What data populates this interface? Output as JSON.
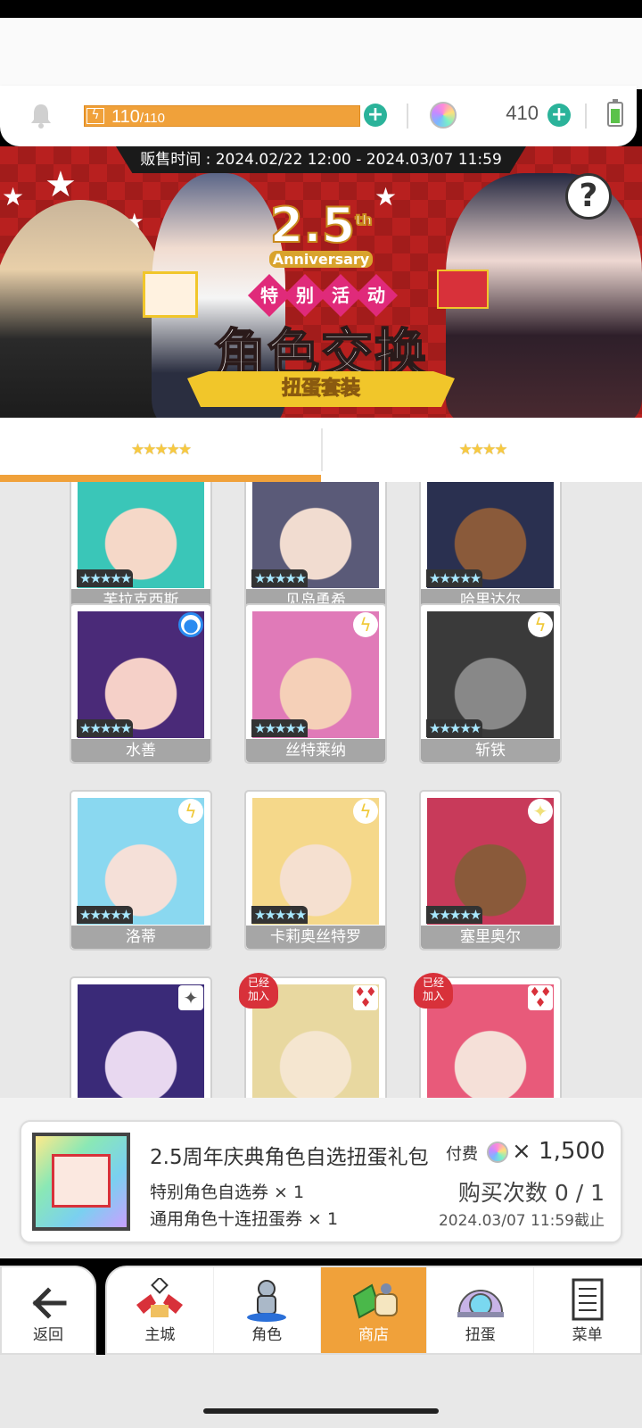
{
  "resources": {
    "stamina_current": "110",
    "stamina_max": "/110",
    "stamina_fill_fraction": 1.0,
    "stamina_icon": "lightning-icon",
    "gems": "410",
    "plus": "+"
  },
  "banner": {
    "sale_time": "贩售时间 : 2024.02/22 12:00 - 2024.03/07 11:59",
    "anniversary_number": "2.5",
    "anniversary_suffix": "th",
    "anniversary_word": "Anniversary",
    "event_tag": [
      "特",
      "别",
      "活",
      "动"
    ],
    "title": "角色交换",
    "ribbon": "扭蛋套装",
    "help": "?"
  },
  "tabs": [
    {
      "label": "★★★★★",
      "active": true
    },
    {
      "label": "★★★★",
      "active": false
    }
  ],
  "characters": [
    {
      "name": "芙拉克西斯",
      "stars": "★★★★★",
      "badge": "",
      "joined": false
    },
    {
      "name": "见岛勇希",
      "stars": "★★★★★",
      "badge": "",
      "joined": false
    },
    {
      "name": "哈里达尔",
      "stars": "★★★★★",
      "badge": "",
      "joined": false
    },
    {
      "name": "水善",
      "stars": "★★★★★",
      "badge": "water-icon",
      "joined": false
    },
    {
      "name": "丝特莱纳",
      "stars": "★★★★★",
      "badge": "lightning-icon",
      "joined": false
    },
    {
      "name": "斩铁",
      "stars": "★★★★★",
      "badge": "lightning-icon",
      "joined": false
    },
    {
      "name": "洛蒂",
      "stars": "★★★★★",
      "badge": "lightning-icon",
      "joined": false
    },
    {
      "name": "卡莉奥丝特罗",
      "stars": "★★★★★",
      "badge": "lightning-icon",
      "joined": false
    },
    {
      "name": "塞里奥尔",
      "stars": "★★★★★",
      "badge": "light-icon",
      "joined": false
    },
    {
      "name": "",
      "stars": "",
      "badge": "dark-icon",
      "joined": false
    },
    {
      "name": "",
      "stars": "",
      "badge": "fire-icon",
      "joined": true
    },
    {
      "name": "",
      "stars": "",
      "badge": "fire-icon",
      "joined": true
    }
  ],
  "joined_label": "已经\n加入",
  "pack": {
    "title": "2.5周年庆典角色自选扭蛋礼包",
    "paid_label": "付费",
    "price": "× 1,500",
    "items": [
      "特别角色自选券 × 1",
      "通用角色十连扭蛋券 × 1"
    ],
    "purchase_count": "购买次数 0 / 1",
    "deadline": "2024.03/07 11:59截止"
  },
  "nav": {
    "back": "返回",
    "items": [
      {
        "label": "主城",
        "icon": "castle-icon",
        "active": false
      },
      {
        "label": "角色",
        "icon": "character-icon",
        "active": false
      },
      {
        "label": "商店",
        "icon": "shop-icon",
        "active": true
      },
      {
        "label": "扭蛋",
        "icon": "gacha-icon",
        "active": false
      },
      {
        "label": "菜单",
        "icon": "menu-icon",
        "active": false
      }
    ]
  },
  "colors": {
    "accent": "#f0a13a",
    "banner_red": "#b8201f",
    "plus_green": "#2bb39a"
  }
}
